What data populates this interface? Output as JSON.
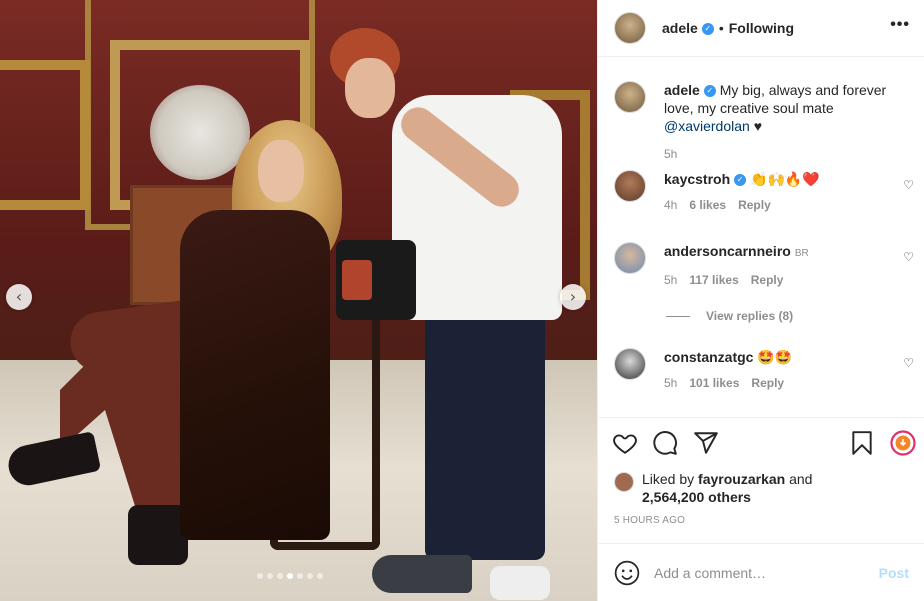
{
  "header": {
    "username": "adele",
    "separator": "•",
    "follow_status": "Following",
    "more_glyph": "•••"
  },
  "caption": {
    "username": "adele",
    "text": "My big, always and forever love, my creative soul mate ",
    "mention": "@xavierdolan",
    "suffix": " ♥",
    "time": "5h"
  },
  "comments": [
    {
      "username": "kaycstroh",
      "verified": true,
      "text": "👏🙌🔥❤️",
      "time": "4h",
      "likes": "6 likes",
      "reply": "Reply"
    },
    {
      "username": "andersoncarnneiro",
      "country": "BR",
      "text": "",
      "time": "5h",
      "likes": "117 likes",
      "reply": "Reply"
    },
    {
      "username": "constanzatgc",
      "text": "🤩🤩",
      "time": "5h",
      "likes": "101 likes",
      "reply": "Reply"
    }
  ],
  "view_replies": "View replies (8)",
  "likes": {
    "prefix": "Liked by ",
    "user": "fayrouzarkan",
    "middle": " and",
    "count": "2,564,200 others"
  },
  "timestamp": "5 HOURS AGO",
  "add_comment": {
    "placeholder": "Add a comment…",
    "post_label": "Post"
  },
  "carousel": {
    "prev_glyph": "‹",
    "next_glyph": "›",
    "slides": 7,
    "active_index": 3
  },
  "icons": [
    "heart-icon",
    "comment-icon",
    "share-icon",
    "bookmark-icon",
    "emoji-icon",
    "verified-icon"
  ],
  "colors": {
    "link": "#00376b",
    "meta": "#8e8e8e",
    "verified": "#3897f0",
    "post_disabled": "#b2dffc"
  }
}
